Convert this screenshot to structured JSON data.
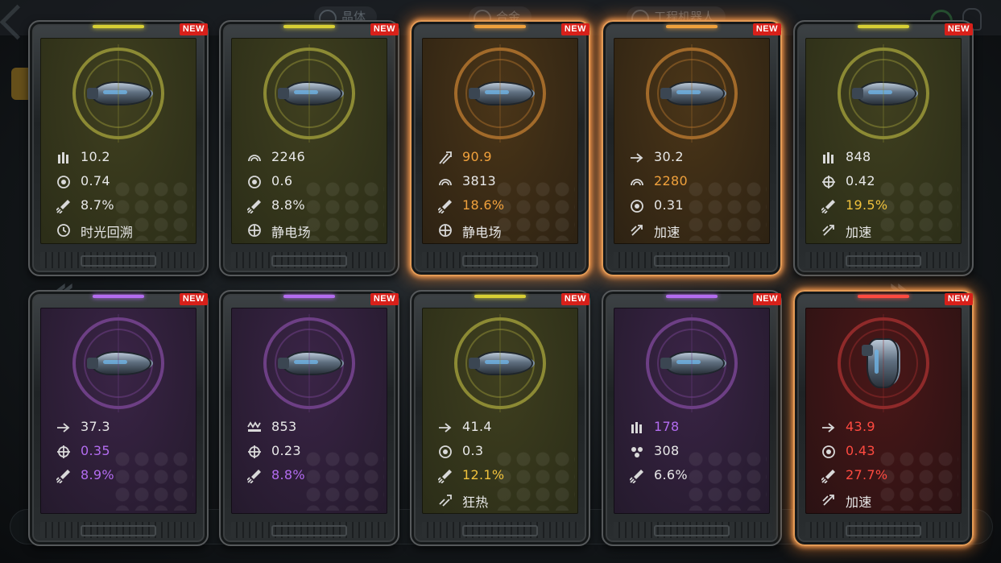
{
  "background": {
    "tabs": [
      "晶体",
      "合金",
      "工程机器人"
    ]
  },
  "theme_colors": {
    "yellow_panel": "#3f3f1f",
    "orange_panel": "#4a3518",
    "purple_panel": "#3a2446",
    "red_panel": "#4a1718",
    "yellow_text": "#f0c23c",
    "orange_text": "#f0a13c",
    "purple_text": "#b36cf0",
    "red_text": "#ff4a40",
    "new_badge": "#d8201a"
  },
  "cards": [
    {
      "theme": "yellow",
      "glow": false,
      "badge": "NEW",
      "ship": "frigate-ship-icon",
      "stats": [
        {
          "icon": "ammo-icon",
          "value": "10.2",
          "highlight": null
        },
        {
          "icon": "reload-icon",
          "value": "0.74",
          "highlight": null
        },
        {
          "icon": "missile-icon",
          "value": "8.7%",
          "highlight": null
        },
        {
          "icon": "time-rewind-icon",
          "value": "时光回溯",
          "highlight": null
        }
      ]
    },
    {
      "theme": "yellow",
      "glow": false,
      "badge": "NEW",
      "ship": "cruiser-ship-icon",
      "stats": [
        {
          "icon": "shield-arc-icon",
          "value": "2246",
          "highlight": null
        },
        {
          "icon": "reload-icon",
          "value": "0.6",
          "highlight": null
        },
        {
          "icon": "missile-icon",
          "value": "8.8%",
          "highlight": null
        },
        {
          "icon": "static-field-icon",
          "value": "静电场",
          "highlight": null
        }
      ]
    },
    {
      "theme": "orange",
      "glow": true,
      "badge": "NEW",
      "ship": "cruiser-ship-icon",
      "stats": [
        {
          "icon": "damage-burst-icon",
          "value": "90.9",
          "highlight": "orange"
        },
        {
          "icon": "shield-arc-icon",
          "value": "3813",
          "highlight": null
        },
        {
          "icon": "missile-icon",
          "value": "18.6%",
          "highlight": "orange"
        },
        {
          "icon": "static-field-icon",
          "value": "静电场",
          "highlight": null
        }
      ]
    },
    {
      "theme": "orange",
      "glow": true,
      "badge": "NEW",
      "ship": "interceptor-ship-icon",
      "stats": [
        {
          "icon": "speed-arrow-icon",
          "value": "30.2",
          "highlight": null
        },
        {
          "icon": "shield-arc-icon",
          "value": "2280",
          "highlight": "orange"
        },
        {
          "icon": "reload-icon",
          "value": "0.31",
          "highlight": null
        },
        {
          "icon": "boost-icon",
          "value": "加速",
          "highlight": null
        }
      ]
    },
    {
      "theme": "yellow",
      "glow": false,
      "badge": "NEW",
      "ship": "destroyer-ship-icon",
      "stats": [
        {
          "icon": "ammo-icon",
          "value": "848",
          "highlight": null
        },
        {
          "icon": "crosshair-icon",
          "value": "0.42",
          "highlight": null
        },
        {
          "icon": "missile-icon",
          "value": "19.5%",
          "highlight": "yellow"
        },
        {
          "icon": "boost-icon",
          "value": "加速",
          "highlight": null
        }
      ]
    },
    {
      "theme": "purple",
      "glow": false,
      "badge": "NEW",
      "ship": "destroyer-ship-icon",
      "stats": [
        {
          "icon": "speed-arrow-icon",
          "value": "37.3",
          "highlight": null
        },
        {
          "icon": "crosshair-icon",
          "value": "0.35",
          "highlight": "purple"
        },
        {
          "icon": "missile-icon",
          "value": "8.9%",
          "highlight": "purple"
        }
      ]
    },
    {
      "theme": "purple",
      "glow": false,
      "badge": "NEW",
      "ship": "cruiser-ship-icon",
      "stats": [
        {
          "icon": "armor-spikes-icon",
          "value": "853",
          "highlight": null
        },
        {
          "icon": "crosshair-icon",
          "value": "0.23",
          "highlight": null
        },
        {
          "icon": "missile-icon",
          "value": "8.8%",
          "highlight": "purple"
        }
      ]
    },
    {
      "theme": "yellow",
      "glow": false,
      "badge": "NEW",
      "ship": "battleship-ship-icon",
      "stats": [
        {
          "icon": "speed-arrow-icon",
          "value": "41.4",
          "highlight": null
        },
        {
          "icon": "reload-icon",
          "value": "0.3",
          "highlight": null
        },
        {
          "icon": "missile-icon",
          "value": "12.1%",
          "highlight": "yellow"
        },
        {
          "icon": "frenzy-icon",
          "value": "狂热",
          "highlight": null
        }
      ]
    },
    {
      "theme": "purple",
      "glow": false,
      "badge": "NEW",
      "ship": "interceptor-ship-icon",
      "stats": [
        {
          "icon": "ammo-icon",
          "value": "178",
          "highlight": "purple"
        },
        {
          "icon": "cluster-icon",
          "value": "308",
          "highlight": null
        },
        {
          "icon": "missile-icon",
          "value": "6.6%",
          "highlight": null
        }
      ]
    },
    {
      "theme": "red",
      "glow": true,
      "badge": "NEW",
      "ship": "vertical-fighter-ship-icon",
      "stats": [
        {
          "icon": "speed-arrow-icon",
          "value": "43.9",
          "highlight": "red"
        },
        {
          "icon": "reload-icon",
          "value": "0.43",
          "highlight": "red"
        },
        {
          "icon": "missile-icon",
          "value": "27.7%",
          "highlight": "red"
        },
        {
          "icon": "boost-icon",
          "value": "加速",
          "highlight": null
        }
      ]
    }
  ]
}
